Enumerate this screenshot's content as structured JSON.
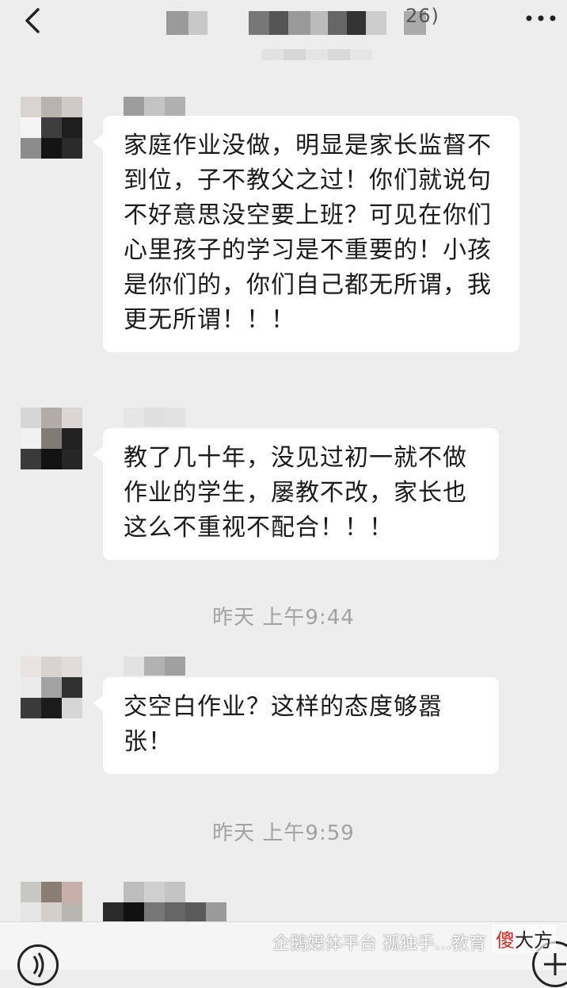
{
  "header": {
    "title_partial": "26)"
  },
  "messages": [
    {
      "text": "家庭作业没做，明显是家长监督不到位，子不教父之过！你们就说句不好意思没空要上班？可见在你们心里孩子的学习是不重要的！小孩是你们的，你们自己都无所谓，我更无所谓！！！"
    },
    {
      "text": "教了几十年，没见过初一就不做作业的学生，屡教不改，家长也这么不重视不配合！！！"
    },
    {
      "text": "交空白作业？这样的态度够嚣张！"
    }
  ],
  "timestamps": [
    "昨天 上午9:44",
    "昨天 上午9:59"
  ],
  "watermark": {
    "platform": "企鹅媒体平台 孤独手...教育",
    "brand_red": "傻",
    "brand_rest": "大方"
  }
}
